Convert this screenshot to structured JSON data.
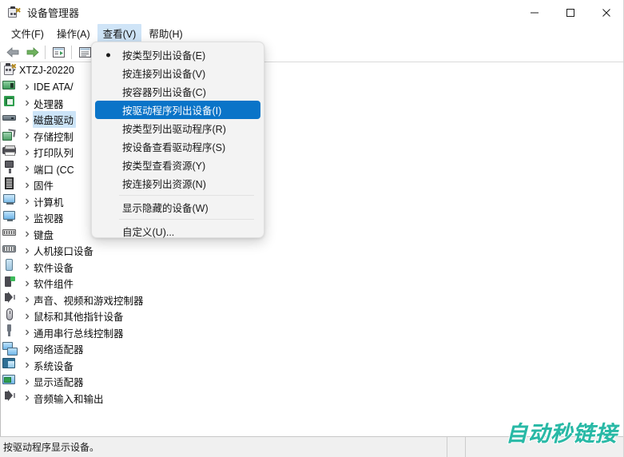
{
  "window": {
    "title": "设备管理器",
    "icon": "device-manager-icon",
    "controls": {
      "minimize": "minimize-icon",
      "maximize": "maximize-icon",
      "close": "close-icon"
    }
  },
  "menubar": {
    "items": [
      {
        "label": "文件(F)",
        "active": false
      },
      {
        "label": "操作(A)",
        "active": false
      },
      {
        "label": "查看(V)",
        "active": true
      },
      {
        "label": "帮助(H)",
        "active": false
      }
    ]
  },
  "toolbar": {
    "buttons": [
      {
        "name": "back-arrow-icon",
        "enabled": true
      },
      {
        "name": "forward-arrow-icon",
        "enabled": true
      },
      {
        "name": "properties-icon",
        "enabled": true
      },
      {
        "name": "show-list-icon",
        "enabled": true
      }
    ]
  },
  "view_menu": {
    "items": [
      {
        "label": "按类型列出设备(E)",
        "bullet": true,
        "selected": false,
        "separator_after": false
      },
      {
        "label": "按连接列出设备(V)",
        "bullet": false,
        "selected": false,
        "separator_after": false
      },
      {
        "label": "按容器列出设备(C)",
        "bullet": false,
        "selected": false,
        "separator_after": false
      },
      {
        "label": "按驱动程序列出设备(I)",
        "bullet": false,
        "selected": true,
        "separator_after": false
      },
      {
        "label": "按类型列出驱动程序(R)",
        "bullet": false,
        "selected": false,
        "separator_after": false
      },
      {
        "label": "按设备查看驱动程序(S)",
        "bullet": false,
        "selected": false,
        "separator_after": false
      },
      {
        "label": "按类型查看资源(Y)",
        "bullet": false,
        "selected": false,
        "separator_after": false
      },
      {
        "label": "按连接列出资源(N)",
        "bullet": false,
        "selected": false,
        "separator_after": true
      },
      {
        "label": "显示隐藏的设备(W)",
        "bullet": false,
        "selected": false,
        "separator_after": true
      },
      {
        "label": "自定义(U)...",
        "bullet": false,
        "selected": false,
        "separator_after": false
      }
    ]
  },
  "device_tree": {
    "root": {
      "label": "XTZJ-20220",
      "icon": "computer-root-icon",
      "expanded": true
    },
    "nodes": [
      {
        "label": "IDE ATA/",
        "icon": "ide-ata-icon",
        "iconclass": "ideata",
        "selected": false
      },
      {
        "label": "处理器",
        "icon": "processor-icon",
        "iconclass": "chipbox",
        "selected": false
      },
      {
        "label": "磁盘驱动",
        "icon": "disk-drive-icon",
        "iconclass": "drive",
        "selected": true
      },
      {
        "label": "存储控制",
        "icon": "storage-controller-icon",
        "iconclass": "storctrl",
        "selected": false
      },
      {
        "label": "打印队列",
        "icon": "print-queue-icon",
        "iconclass": "printer",
        "selected": false
      },
      {
        "label": "端口 (CC",
        "icon": "ports-icon",
        "iconclass": "port",
        "selected": false
      },
      {
        "label": "固件",
        "icon": "firmware-icon",
        "iconclass": "firmware",
        "selected": false
      },
      {
        "label": "计算机",
        "icon": "computer-icon",
        "iconclass": "computer",
        "selected": false
      },
      {
        "label": "监视器",
        "icon": "monitor-icon",
        "iconclass": "mon",
        "selected": false
      },
      {
        "label": "键盘",
        "icon": "keyboard-icon",
        "iconclass": "keyboard",
        "selected": false
      },
      {
        "label": "人机接口设备",
        "icon": "hid-icon",
        "iconclass": "hid",
        "selected": false
      },
      {
        "label": "软件设备",
        "icon": "software-device-icon",
        "iconclass": "softdev",
        "selected": false
      },
      {
        "label": "软件组件",
        "icon": "software-component-icon",
        "iconclass": "softcomp",
        "selected": false
      },
      {
        "label": "声音、视频和游戏控制器",
        "icon": "sound-video-game-icon",
        "iconclass": "speaker",
        "selected": false
      },
      {
        "label": "鼠标和其他指针设备",
        "icon": "mouse-icon",
        "iconclass": "mouse",
        "selected": false
      },
      {
        "label": "通用串行总线控制器",
        "icon": "usb-controller-icon",
        "iconclass": "usb",
        "selected": false
      },
      {
        "label": "网络适配器",
        "icon": "network-adapter-icon",
        "iconclass": "netad",
        "selected": false
      },
      {
        "label": "系统设备",
        "icon": "system-device-icon",
        "iconclass": "sysdev",
        "selected": false
      },
      {
        "label": "显示适配器",
        "icon": "display-adapter-icon",
        "iconclass": "dispad",
        "selected": false
      },
      {
        "label": "音频输入和输出",
        "icon": "audio-io-icon",
        "iconclass": "speaker",
        "selected": false
      }
    ]
  },
  "statusbar": {
    "message": "按驱动程序显示设备。",
    "cell2": "",
    "cell3": ""
  },
  "watermark": {
    "text": "自动秒链接",
    "color": "#29b9a6"
  },
  "colors": {
    "menu_highlight": "#0a74c8",
    "tree_selection": "#cce4f7",
    "menubar_active": "#cfe4f7",
    "statusbar_bg": "#f0f0f0",
    "dropdown_bg": "#f3f3f3"
  }
}
